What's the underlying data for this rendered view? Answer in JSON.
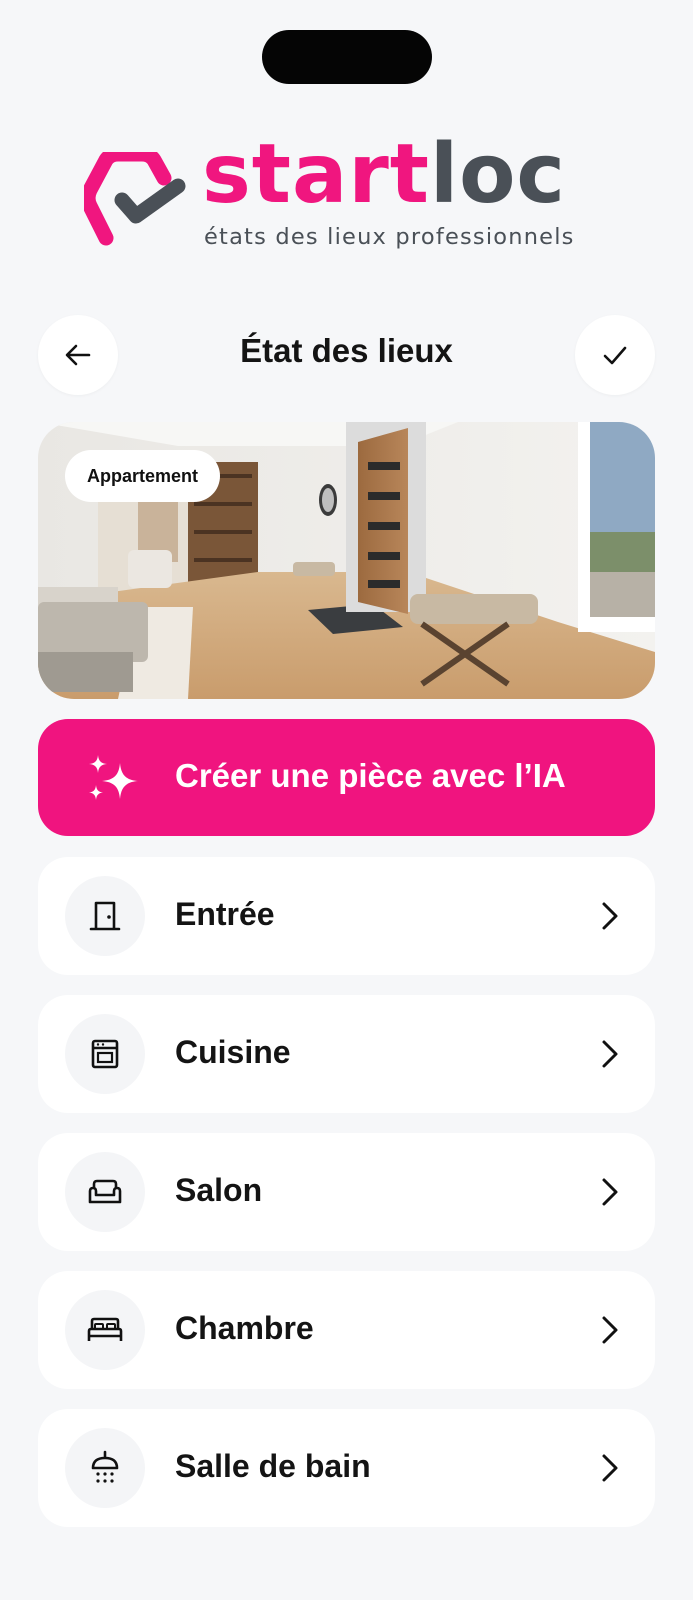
{
  "brand": {
    "name_part1": "start",
    "name_part2": "loc",
    "tagline": "états des lieux professionnels",
    "primary_color": "#f0167f",
    "secondary_color": "#4a5057"
  },
  "header": {
    "title": "État des lieux",
    "back_icon": "arrow-left-icon",
    "confirm_icon": "checkmark-icon"
  },
  "property": {
    "type_badge": "Appartement"
  },
  "ai_button": {
    "label": "Créer une pièce avec l’IA",
    "icon": "sparkles-icon",
    "color": "#f0147f"
  },
  "rooms": [
    {
      "label": "Entrée",
      "icon": "door-icon"
    },
    {
      "label": "Cuisine",
      "icon": "oven-icon"
    },
    {
      "label": "Salon",
      "icon": "sofa-icon"
    },
    {
      "label": "Chambre",
      "icon": "bed-icon"
    },
    {
      "label": "Salle de bain",
      "icon": "shower-icon"
    }
  ]
}
